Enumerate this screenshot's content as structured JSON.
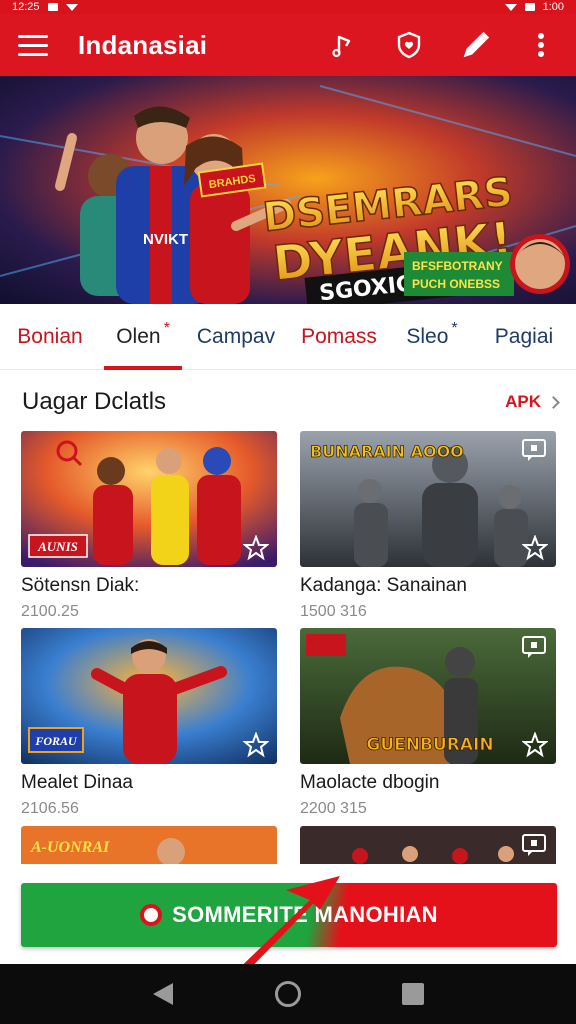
{
  "status_bar": {
    "time": "12:25",
    "battery": "1:00"
  },
  "app_bar": {
    "title": "Indanasiai",
    "menu_icon": "hamburger-menu-icon",
    "actions": [
      "music-note-icon",
      "shield-heart-icon",
      "pencil-icon",
      "more-vert-icon"
    ]
  },
  "banner": {
    "headline_1": "DSEMRARS",
    "headline_2": "DYEANK!",
    "subline": "SGOXICBS",
    "jersey_text": "NVIKT",
    "tag_top": "BRAHDS",
    "promo_line_1": "BFSFBOTRANY",
    "promo_line_2": "PUCH ONEBSS"
  },
  "tabs": [
    {
      "label": "Bonian",
      "mark": ""
    },
    {
      "label": "Olen",
      "mark": "*"
    },
    {
      "label": "Campav",
      "mark": ""
    },
    {
      "label": "Pomass",
      "mark": ""
    },
    {
      "label": "Sleo",
      "mark": "*"
    },
    {
      "label": "Pagiai",
      "mark": ""
    }
  ],
  "section": {
    "title": "Uagar Dclatls",
    "link": "APK"
  },
  "cards": [
    {
      "title": "Sötensn Diak:",
      "meta": "2100.25",
      "badge": "AUNIS"
    },
    {
      "title": "Kadanga: Sanainan",
      "meta": "1500 316",
      "badge": "BUNARAIN AOOO"
    },
    {
      "title": "Mealet Dinaa",
      "meta": "2106.56",
      "badge": "FORAU"
    },
    {
      "title": "Maolacte dbogin",
      "meta": "2200 315",
      "badge": "GUENBURAIN"
    },
    {
      "title": "",
      "meta": "",
      "badge": "A-UONRAI"
    },
    {
      "title": "",
      "meta": "",
      "badge": ""
    }
  ],
  "cta": {
    "label": "SOMMERITE MANOHIAN"
  },
  "colors": {
    "brand_red": "#dc1620",
    "cta_green": "#1fa43f",
    "nav_dark": "#0c0c0c"
  }
}
